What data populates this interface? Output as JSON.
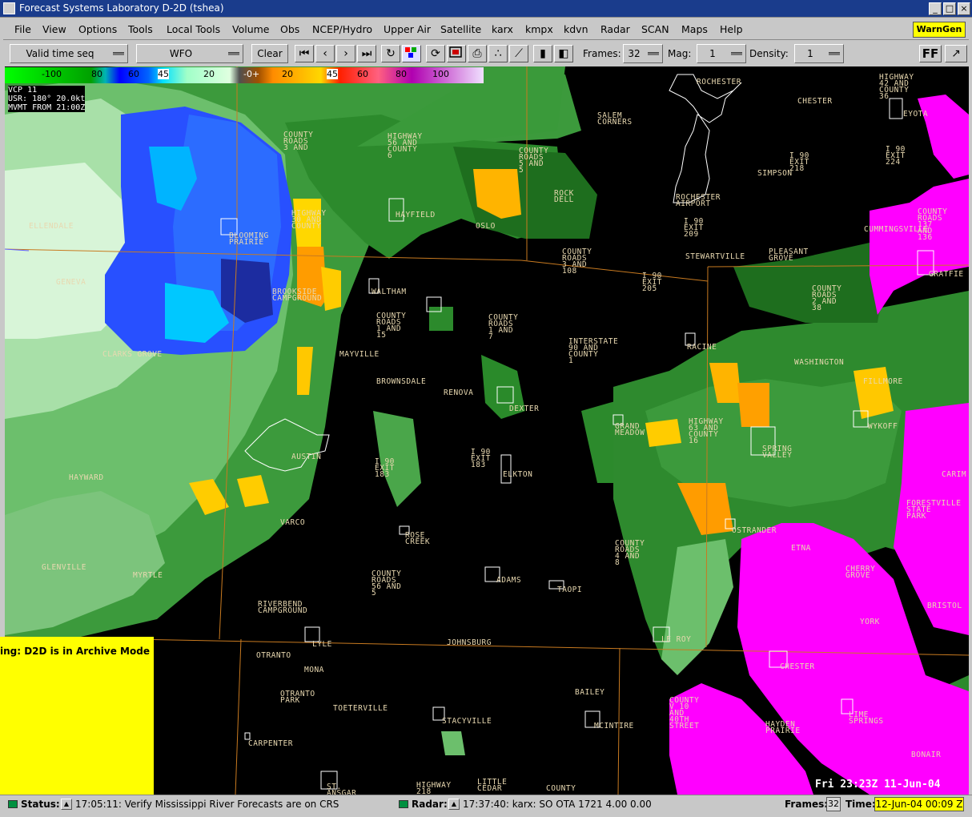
{
  "window": {
    "title": "Forecast Systems Laboratory D-2D (tshea)",
    "buttons": [
      "_",
      "□",
      "×"
    ]
  },
  "menu": {
    "items": [
      "File",
      "View",
      "Options",
      "Tools",
      "Local Tools",
      "Volume",
      "Obs",
      "NCEP/Hydro",
      "Upper Air",
      "Satellite",
      "karx",
      "kmpx",
      "kdvn",
      "Radar",
      "SCAN",
      "Maps",
      "Help"
    ],
    "warngen": "WarnGen"
  },
  "toolbar": {
    "time_mode": "Valid time seq",
    "scale": "WFO",
    "clear": "Clear",
    "frames_label": "Frames:",
    "frames_value": "32",
    "mag_label": "Mag:",
    "mag_value": "1",
    "density_label": "Density:",
    "density_value": "1",
    "ff": "FF",
    "icons": [
      "first-frame-icon",
      "prev-frame-icon",
      "next-frame-icon",
      "last-frame-icon",
      "loop-icon",
      "image-properties-icon",
      "refresh-icon",
      "swap-icon",
      "print-icon",
      "points-icon",
      "baseline-icon",
      "single-panel-icon",
      "dual-panel-icon",
      "cursor-icon"
    ]
  },
  "colorbar": {
    "labels": [
      "-100",
      "80",
      "60",
      "45",
      "20",
      "-0+",
      "20",
      "45",
      "60",
      "80",
      "100"
    ],
    "colors": [
      "#00ff00",
      "#00aa00",
      "#0000ff",
      "#3c78ff",
      "#00c8ff",
      "#80ffa0",
      "#ff8c00",
      "#ffd700",
      "#ff0000",
      "#ff78b4",
      "#ff00ff"
    ]
  },
  "radar_info": {
    "line1": "VCP 11",
    "line2": "USR: 180°  20.0kt",
    "line3": "MVMT FROM  21:00Z"
  },
  "towns": [
    {
      "n": "ROCHESTER"
    },
    {
      "n": "HIGHWAY\n42 AND\nCOUNTY\n36"
    },
    {
      "n": "CHESTER"
    },
    {
      "n": "EYOTA"
    },
    {
      "n": "SALEM\nCORNERS"
    },
    {
      "n": "COUNTY\nROADS\n3 AND"
    },
    {
      "n": "HIGHWAY\n56 AND\nCOUNTY\n6"
    },
    {
      "n": "COUNTY\nROADS\n5 AND\n5"
    },
    {
      "n": "I 90\nEXIT\n218"
    },
    {
      "n": "I 90\nEXIT\n224"
    },
    {
      "n": "SIMPSON"
    },
    {
      "n": "ROCK\nDELL"
    },
    {
      "n": "ROCHESTER\nAIRPORT"
    },
    {
      "n": "COUNTY\nROADS\n137\nAND\n136"
    },
    {
      "n": "ELLENDALE"
    },
    {
      "n": "HIGHWAY\n30 AND\nCOUNTY"
    },
    {
      "n": "HAYFIELD"
    },
    {
      "n": "OSLO"
    },
    {
      "n": "I 90\nEXIT\n209"
    },
    {
      "n": "CUMMINGSVILLE"
    },
    {
      "n": "BLOOMING\nPRAIRIE"
    },
    {
      "n": "STEWARTVILLE"
    },
    {
      "n": "PLEASANT\nGROVE"
    },
    {
      "n": "COUNTY\nROADS\n3 AND\n108"
    },
    {
      "n": "GRATFIE"
    },
    {
      "n": "GENEVA"
    },
    {
      "n": "I 90\nEXIT\n205"
    },
    {
      "n": "BROOKSIDE\nCAMPGROUND"
    },
    {
      "n": "WALTHAM"
    },
    {
      "n": "COUNTY\nROADS\n2 AND\n38"
    },
    {
      "n": "COUNTY\nROADS\n1 AND\n15"
    },
    {
      "n": "COUNTY\nROADS\n1 AND\n7"
    },
    {
      "n": "INTERSTATE\n90 AND\nCOUNTY\n1"
    },
    {
      "n": "RACINE"
    },
    {
      "n": "CLARKS GROVE"
    },
    {
      "n": "MAYVILLE"
    },
    {
      "n": "WASHINGTON"
    },
    {
      "n": "BROWNSDALE"
    },
    {
      "n": "RENOVA"
    },
    {
      "n": "FILLMORE"
    },
    {
      "n": "DEXTER"
    },
    {
      "n": "GRAND\nMEADOW"
    },
    {
      "n": "HIGHWAY\n63 AND\nCOUNTY\n16"
    },
    {
      "n": "WYKOFF"
    },
    {
      "n": "SPRING\nVALLEY"
    },
    {
      "n": "AUSTIN"
    },
    {
      "n": "I 90\nEXIT\n183"
    },
    {
      "n": "I 90\nEXIT\n183"
    },
    {
      "n": "ELKTON"
    },
    {
      "n": "HAYWARD"
    },
    {
      "n": "CARIM"
    },
    {
      "n": "FORESTVILLE\nSTATE\nPARK"
    },
    {
      "n": "VARCO"
    },
    {
      "n": "ROSE\nCREEK"
    },
    {
      "n": "OSTRANDER"
    },
    {
      "n": "COUNTY\nROADS\n4 AND\n8"
    },
    {
      "n": "ETNA"
    },
    {
      "n": "GLENVILLE"
    },
    {
      "n": "MYRTLE"
    },
    {
      "n": "COUNTY\nROADS\n56 AND\n5"
    },
    {
      "n": "ADAMS"
    },
    {
      "n": "TAOPI"
    },
    {
      "n": "CHERRY\nGROVE"
    },
    {
      "n": "RIVERBEND\nCAMPGROUND"
    },
    {
      "n": "BRISTOL"
    },
    {
      "n": "YORK"
    },
    {
      "n": "LYLE"
    },
    {
      "n": "JOHNSBURG"
    },
    {
      "n": "LE ROY"
    },
    {
      "n": "OTRANTO"
    },
    {
      "n": "CHESTER"
    },
    {
      "n": "MONA"
    },
    {
      "n": "BAILEY"
    },
    {
      "n": "OTRANTO\nPARK"
    },
    {
      "n": "TOETERVILLE"
    },
    {
      "n": "COUNTY\nV 10\nAND\n40TH\nSTREET"
    },
    {
      "n": "LIME\nSPRINGS"
    },
    {
      "n": "STACYVILLE"
    },
    {
      "n": "MCINTIRE"
    },
    {
      "n": "HAYDEN\nPRAIRIE"
    },
    {
      "n": "CARPENTER"
    },
    {
      "n": "BONAIR"
    },
    {
      "n": "ST.\nANSGAR"
    },
    {
      "n": "HIGHWAY\n218"
    },
    {
      "n": "LITTLE\nCEDAR"
    },
    {
      "n": "COUNTY"
    }
  ],
  "archive_msg": "ing: D2D is in Archive Mode",
  "time_annotation": "Fri 23:23Z 11-Jun-04",
  "status": {
    "status_label": "Status:",
    "status_text": "17:05:11: Verify Mississippi River Forecasts are on CRS",
    "radar_label": "Radar:",
    "radar_text": "17:37:40: karx: SO  OTA 1721  4.00  0.00",
    "frames_label": "Frames:",
    "frames_value": "32",
    "time_label": "Time:",
    "time_value": "12-Jun-04 00:09 Z"
  }
}
